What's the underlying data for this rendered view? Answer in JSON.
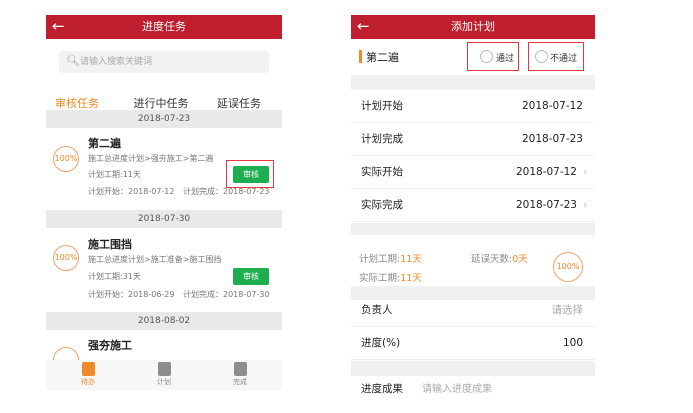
{
  "left": {
    "title": "进度任务",
    "search_placeholder": "请输入搜索关键词",
    "tabs": [
      {
        "label": "审核任务",
        "active": true
      },
      {
        "label": "进行中任务",
        "active": false
      },
      {
        "label": "延误任务",
        "active": false
      }
    ],
    "groups": [
      {
        "date": "2018-07-23",
        "task": {
          "percent": "100%",
          "name": "第二遍",
          "path": "施工总进度计划>强夯施工>第二遍",
          "duration": "计划工期:11天",
          "plan_start": "计划开始：2018-07-12",
          "plan_end": "计划完成：2018-07-23",
          "button": "审核"
        }
      },
      {
        "date": "2018-07-30",
        "task": {
          "percent": "100%",
          "name": "施工围挡",
          "path": "施工总进度计划>施工准备>施工围挡",
          "duration": "计划工期:31天",
          "plan_start": "计划开始：2018-06-29",
          "plan_end": "计划完成：2018-07-30",
          "button": "审核"
        }
      },
      {
        "date": "2018-08-02",
        "task": {
          "name": "强夯施工"
        }
      }
    ],
    "nav": [
      {
        "label": "待办",
        "icon": "todo-icon",
        "active": true
      },
      {
        "label": "计划",
        "icon": "plan-icon",
        "active": false
      },
      {
        "label": "完成",
        "icon": "done-icon",
        "active": false
      }
    ]
  },
  "right": {
    "title": "添加计划",
    "task_name": "第二遍",
    "options": {
      "approve": "通过",
      "reject": "不通过"
    },
    "fields": [
      {
        "label": "计划开始",
        "value": "2018-07-12"
      },
      {
        "label": "计划完成",
        "value": "2018-07-23"
      },
      {
        "label": "实际开始",
        "value": "2018-07-12",
        "arrow": true
      },
      {
        "label": "实际完成",
        "value": "2018-07-23",
        "arrow": true
      }
    ],
    "stats": {
      "plan_label": "计划工期:",
      "plan_value": "11天",
      "delay_label": "延误天数:",
      "delay_value": "0天",
      "actual_label": "实际工期:",
      "actual_value": "11天",
      "percent": "100%"
    },
    "owner": {
      "label": "负责人",
      "placeholder": "请选择"
    },
    "progress": {
      "label": "进度(%)",
      "value": "100"
    },
    "result": {
      "label": "进度成果",
      "placeholder": "请输入进度成果"
    }
  },
  "colors": {
    "brand_red": "#bf1e2e",
    "accent_orange": "#f08a28",
    "audit_green": "#1fae4f",
    "highlight_red": "#e03a3a"
  }
}
